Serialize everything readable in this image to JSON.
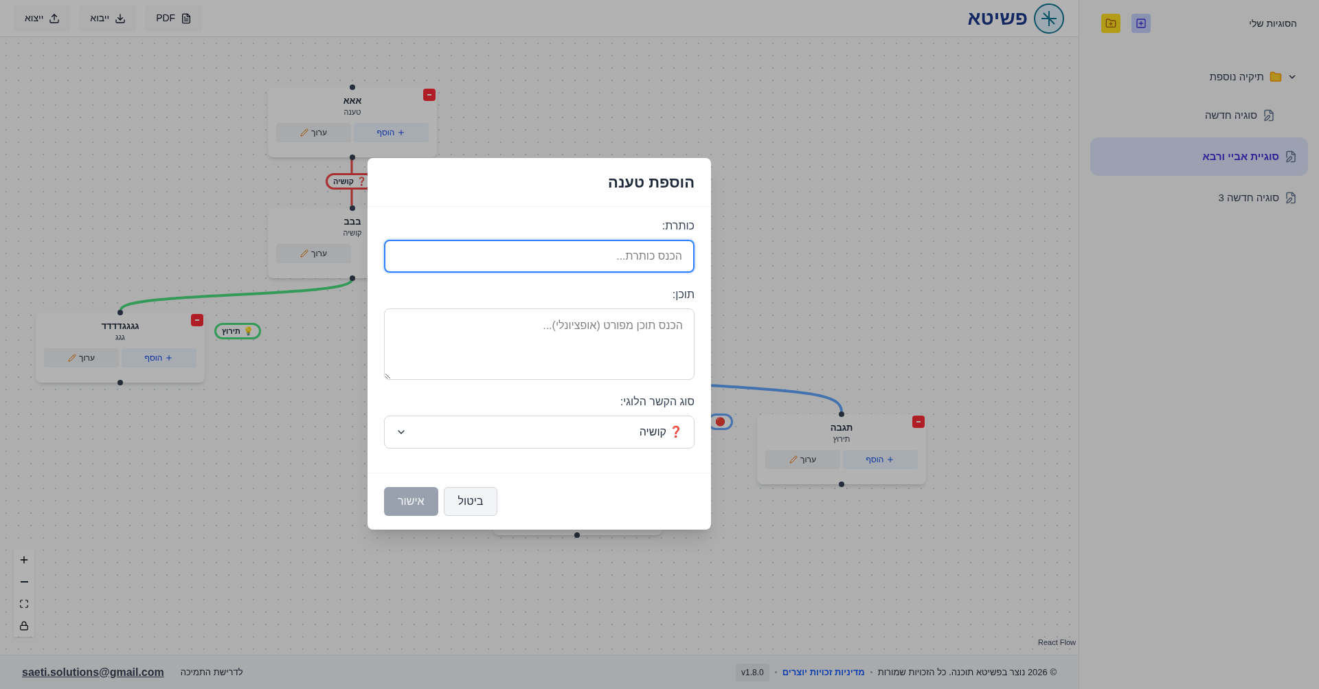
{
  "toolbar": {
    "buttons": [
      {
        "label": "PDF",
        "kind": "pdf"
      },
      {
        "label": "ייבוא",
        "kind": "import"
      },
      {
        "label": "ייצוא",
        "kind": "export"
      }
    ],
    "logo": "פשיטא"
  },
  "canvas": {
    "nodes": [
      {
        "title": "אאא",
        "subtitle": "טענה",
        "add": "הוסף",
        "edit": "ערוך"
      },
      {
        "title": "בבב",
        "subtitle": "קושיה",
        "edit": "ערוך"
      },
      {
        "title": "גגגגדדדד",
        "subtitle": "גגג",
        "add": "הוסף",
        "edit": "ערוך"
      },
      {
        "title": "תגבה",
        "subtitle": "תירוץ",
        "add": "הוסף",
        "edit": "ערוך"
      }
    ],
    "edges": [
      {
        "label": "קושיה",
        "icon": "❓",
        "color": "#a73030"
      },
      {
        "label": "תירוץ",
        "icon": "💡",
        "color": "#339b59"
      },
      {
        "icon": "🔴",
        "color": "#4373af"
      }
    ],
    "attribution": "React Flow"
  },
  "footer": {
    "email": "saeti.solutions@gmail.com",
    "support": "לדרישת התמיכה",
    "copyright": "© 2026 נוצר בפשיטא תוכנה. כל הזכויות שמורות",
    "link": "מדיניות זכויות יוצרים",
    "version": "v1.8.0"
  },
  "sidebar": {
    "title": "הסוגיות שלי",
    "items": [
      {
        "label": "תיקיה נוספת",
        "kind": "folder",
        "expanded": true,
        "selected": false,
        "children": [
          {
            "label": "סוגיה חדשה",
            "kind": "doc",
            "selected": false
          }
        ]
      },
      {
        "label": "סוגיית אביי ורבא",
        "kind": "doc",
        "selected": true
      },
      {
        "label": "סוגיה חדשה 3",
        "kind": "doc",
        "selected": false
      }
    ]
  },
  "dialog": {
    "title": "הוספת טענה",
    "fields": [
      {
        "label": "כותרת:",
        "placeholder": "הכנס כותרת...",
        "kind": "input",
        "focused": true
      },
      {
        "label": "תוכן:",
        "placeholder": "הכנס תוכן מפורט (אופציונלי)...",
        "kind": "textarea",
        "focused": false
      },
      {
        "label": "סוג הקשר הלוגי:",
        "value": "קושיה",
        "icon": "❓",
        "kind": "select",
        "focused": false
      }
    ],
    "buttons": [
      {
        "label": "ביטול",
        "disabled": false
      },
      {
        "label": "אישור",
        "disabled": true
      }
    ]
  }
}
